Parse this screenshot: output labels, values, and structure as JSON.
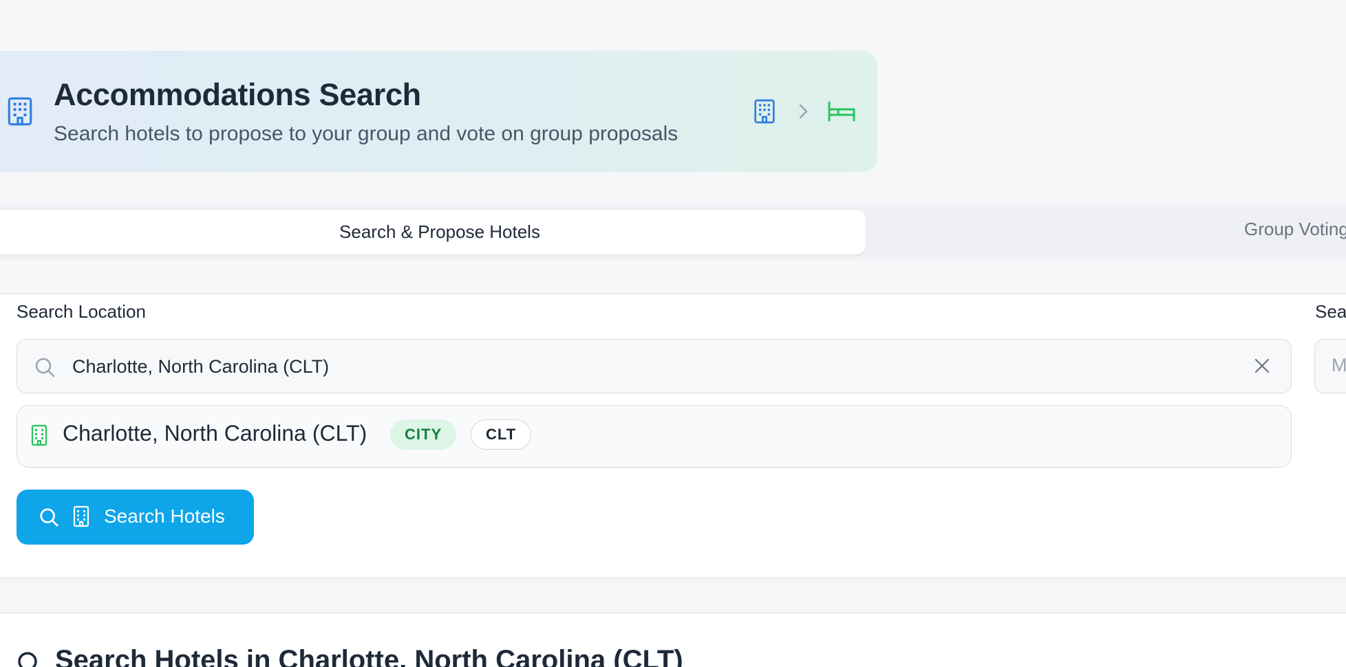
{
  "header": {
    "title": "Accommodations Search",
    "subtitle": "Search hotels to propose to your group and vote on group proposals",
    "icons": [
      "building-icon",
      "chevron-right-icon",
      "bed-icon"
    ]
  },
  "tabs": [
    {
      "label": "Search & Propose Hotels",
      "active": true
    },
    {
      "label": "Group Voting",
      "active": false
    }
  ],
  "search": {
    "location_label": "Search Location",
    "second_label": "Search",
    "location_value": "Charlotte, North Carolina (CLT)",
    "second_placeholder": "M",
    "suggestion": {
      "name": "Charlotte, North Carolina (CLT)",
      "type_badge": "CITY",
      "code_badge": "CLT"
    },
    "button_label": "Search Hotels"
  },
  "results": {
    "title": "Search Hotels in Charlotte, North Carolina (CLT)"
  },
  "colors": {
    "primary": "#0ea5e9",
    "blue_icon": "#2f7de1",
    "green_icon": "#22c55e",
    "city_badge_bg": "#dcf5e6",
    "city_badge_text": "#15803d"
  }
}
